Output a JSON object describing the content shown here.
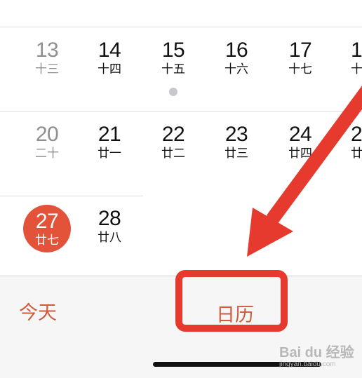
{
  "calendar": {
    "rows": [
      [
        {
          "num": "13",
          "lunar": "十三"
        },
        {
          "num": "14",
          "lunar": "十四"
        },
        {
          "num": "15",
          "lunar": "十五"
        },
        {
          "num": "16",
          "lunar": "十六"
        },
        {
          "num": "17",
          "lunar": "十七"
        },
        {
          "num": "1",
          "lunar": "十"
        }
      ],
      [
        {
          "num": "20",
          "lunar": "二十"
        },
        {
          "num": "21",
          "lunar": "廿一"
        },
        {
          "num": "22",
          "lunar": "廿二"
        },
        {
          "num": "23",
          "lunar": "廿三"
        },
        {
          "num": "24",
          "lunar": "廿四"
        },
        {
          "num": "2",
          "lunar": "廿"
        }
      ],
      [
        {
          "num": "27",
          "lunar": "廿七"
        },
        {
          "num": "28",
          "lunar": "廿八"
        }
      ]
    ]
  },
  "toolbar": {
    "today_label": "今天",
    "calendars_label": "日历"
  },
  "watermark": {
    "brand": "Bai du 经验",
    "url": "jingyan.baidu.com"
  },
  "colors": {
    "accent": "#d05a3c",
    "today_circle": "#e2533a",
    "annotation_red": "#e63a2e"
  }
}
